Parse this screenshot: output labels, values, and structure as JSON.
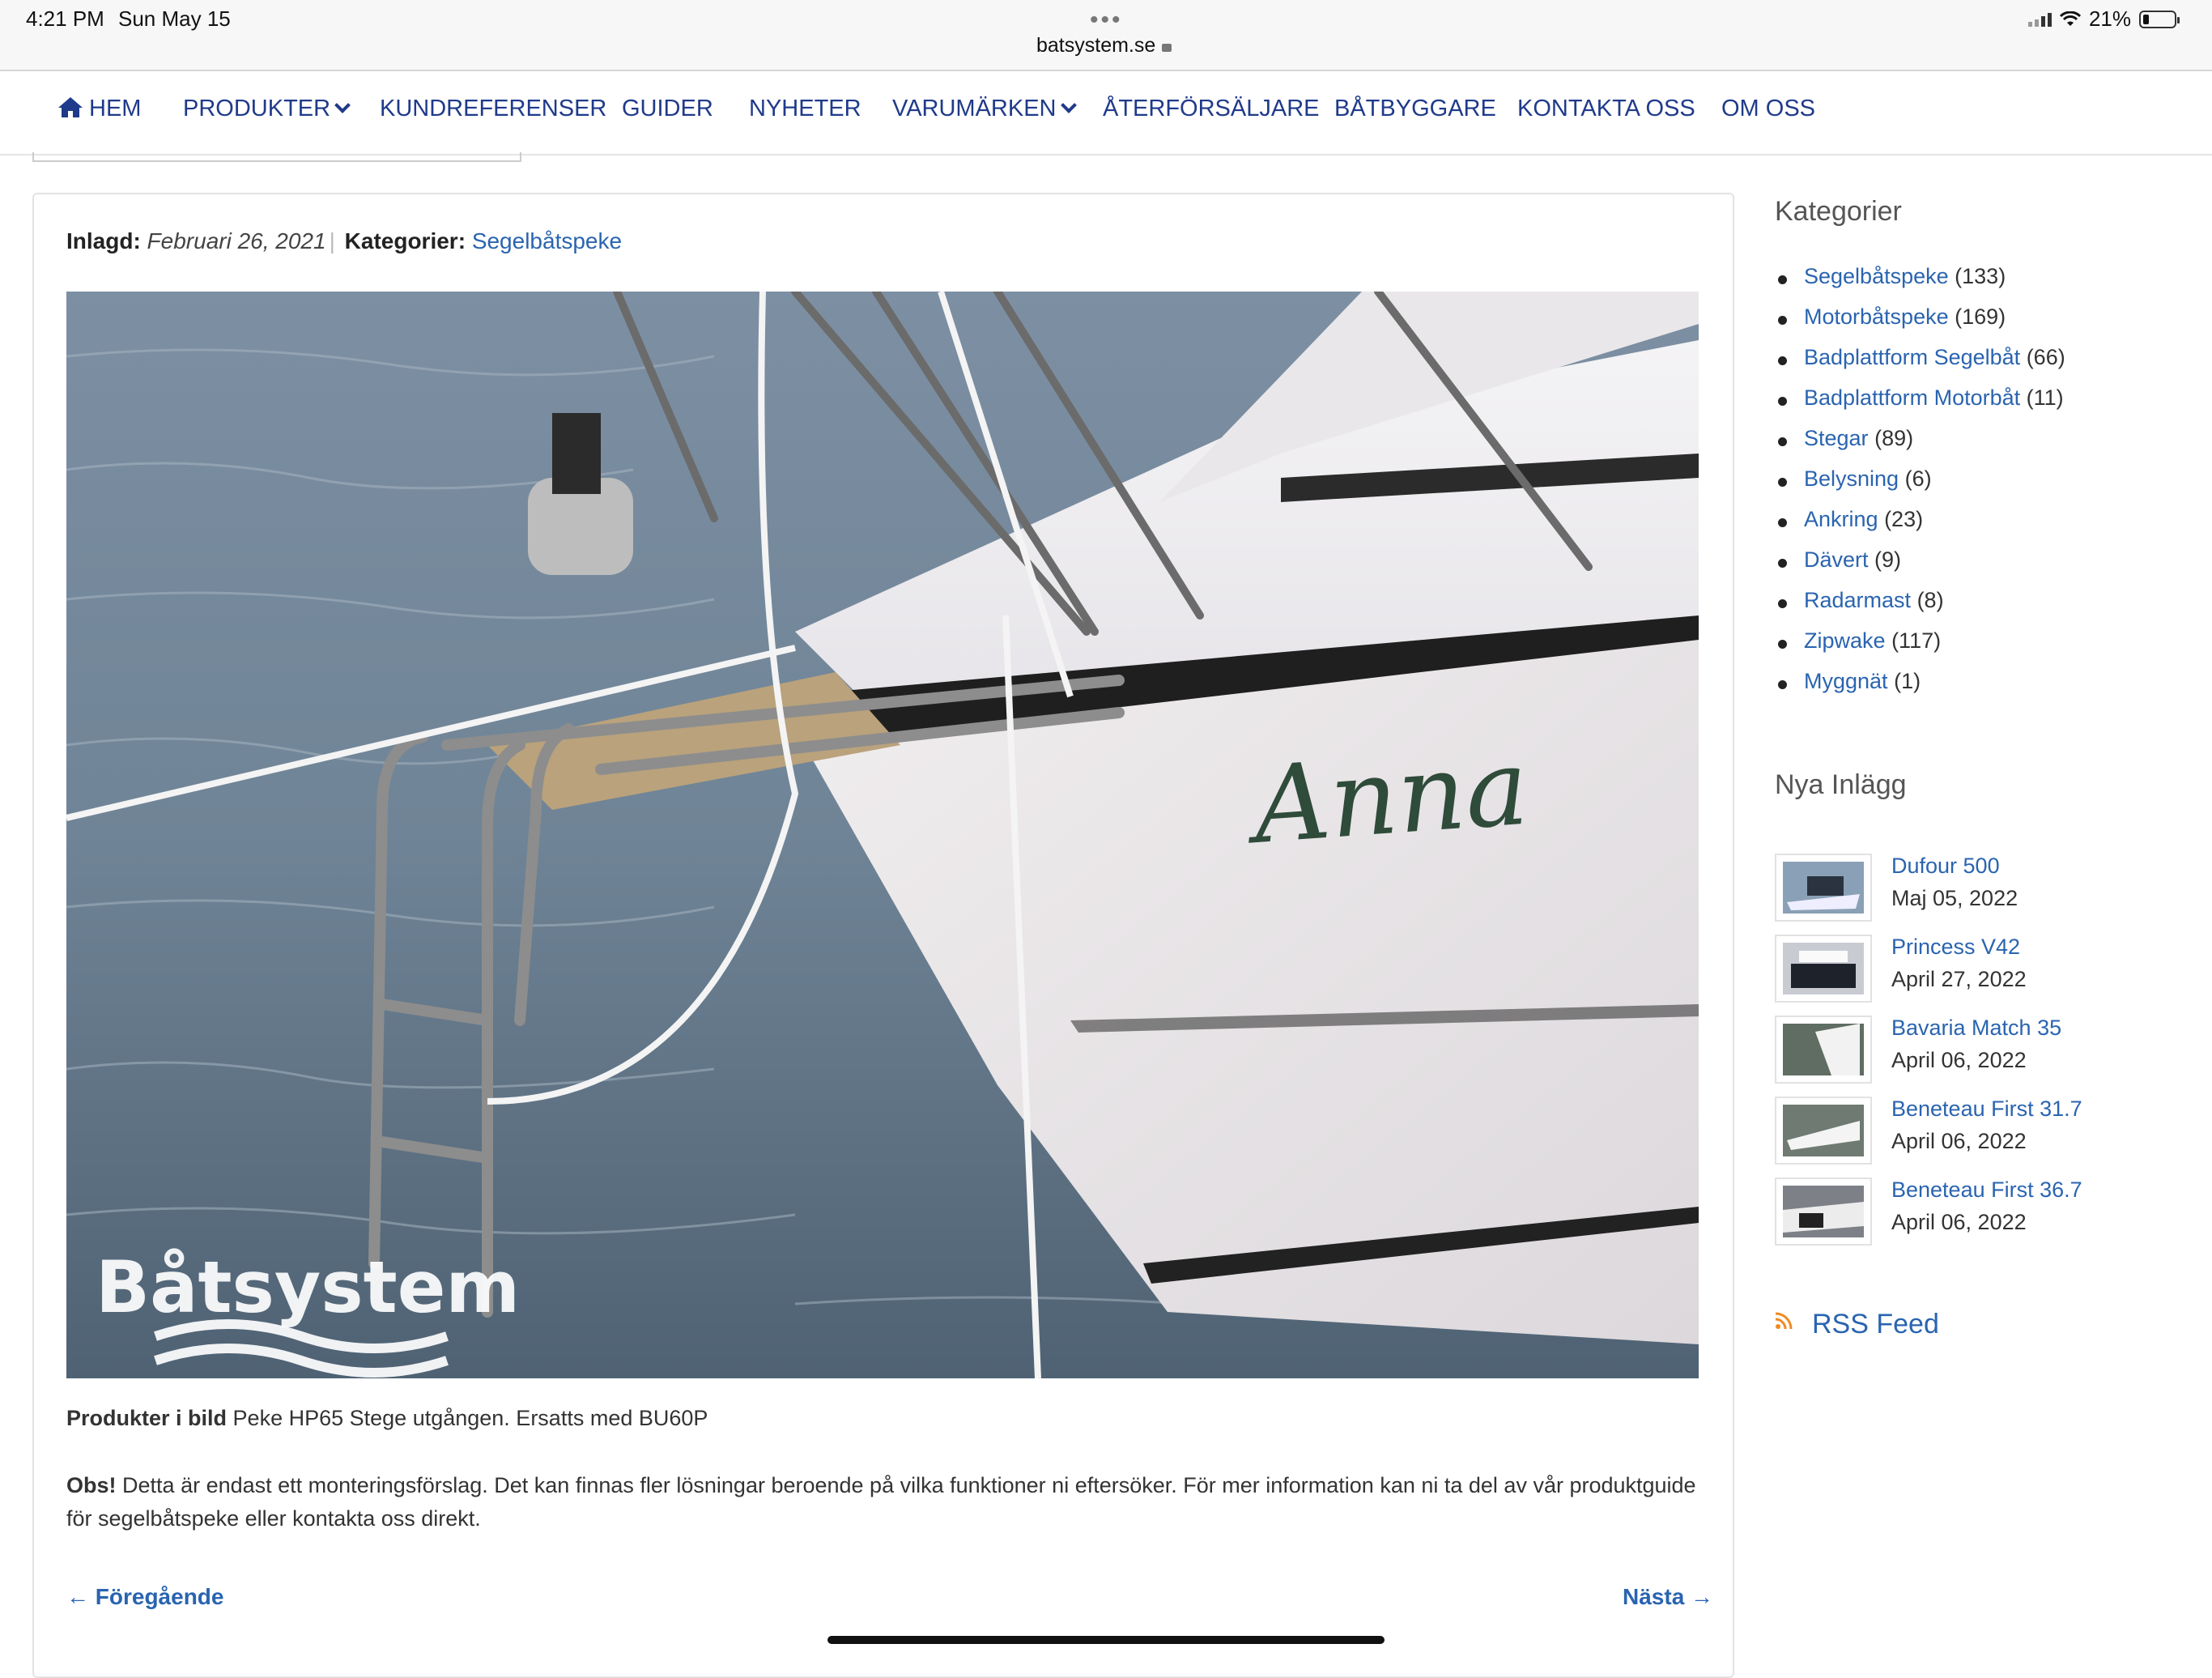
{
  "status_bar": {
    "time": "4:21 PM",
    "date": "Sun May 15",
    "dots": "•••",
    "url": "batsystem.se",
    "battery": "21%"
  },
  "nav": {
    "items": [
      {
        "label": "HEM"
      },
      {
        "label": "PRODUKTER"
      },
      {
        "label": "KUNDREFERENSER"
      },
      {
        "label": "GUIDER"
      },
      {
        "label": "NYHETER"
      },
      {
        "label": "VARUMÄRKEN"
      },
      {
        "label": "ÅTERFÖRSÄLJARE"
      },
      {
        "label": "BÅTBYGGARE"
      },
      {
        "label": "KONTAKTA OSS"
      },
      {
        "label": "OM OSS"
      }
    ]
  },
  "article": {
    "posted_label": "Inlagd:",
    "posted_date": "Februari 26, 2021",
    "category_label": "Kategorier:",
    "category": "Segelbåtspeke",
    "image_boat_name": "Anna",
    "image_watermark": "Båtsystem",
    "caption_bold": "Produkter i bild",
    "caption_text": "Peke HP65 Stege utgången. Ersatts med BU60P",
    "note_bold": "Obs!",
    "note_text": "Detta är endast ett monteringsförslag. Det kan finnas fler lösningar beroende på vilka funktioner ni eftersöker. För mer information kan ni ta del av vår produktguide för segelbåtspeke eller kontakta oss direkt.",
    "prev_label": "← Föregående",
    "next_label": "Nästa →"
  },
  "sidebar": {
    "categories_heading": "Kategorier",
    "categories": [
      {
        "name": "Segelbåtspeke",
        "count": "(133)"
      },
      {
        "name": "Motorbåtspeke",
        "count": "(169)"
      },
      {
        "name": "Badplattform Segelbåt",
        "count": "(66)"
      },
      {
        "name": "Badplattform Motorbåt",
        "count": "(11)"
      },
      {
        "name": "Stegar",
        "count": "(89)"
      },
      {
        "name": "Belysning",
        "count": "(6)"
      },
      {
        "name": "Ankring",
        "count": "(23)"
      },
      {
        "name": "Dävert",
        "count": "(9)"
      },
      {
        "name": "Radarmast",
        "count": "(8)"
      },
      {
        "name": "Zipwake",
        "count": "(117)"
      },
      {
        "name": "Myggnät",
        "count": "(1)"
      }
    ],
    "recent_heading": "Nya Inlägg",
    "recent_posts": [
      {
        "title": "Dufour 500",
        "date": "Maj 05, 2022"
      },
      {
        "title": "Princess V42",
        "date": "April 27, 2022"
      },
      {
        "title": "Bavaria Match 35",
        "date": "April 06, 2022"
      },
      {
        "title": "Beneteau First 31.7",
        "date": "April 06, 2022"
      },
      {
        "title": "Beneteau First 36.7",
        "date": "April 06, 2022"
      }
    ],
    "rss_label": "RSS Feed"
  },
  "colors": {
    "nav_link": "#1f3a8a",
    "link": "#2a64b0"
  }
}
